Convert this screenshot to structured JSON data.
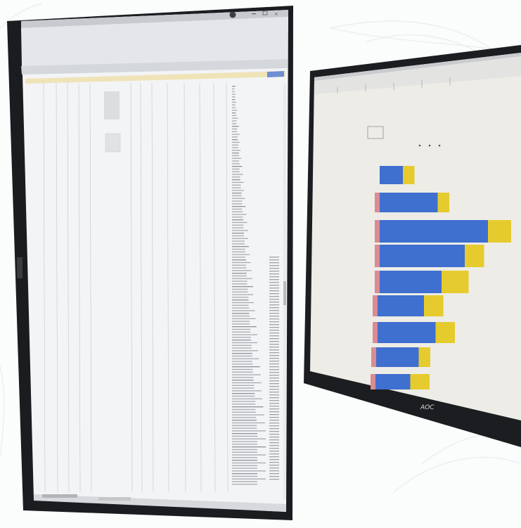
{
  "scene": {
    "description_free": true,
    "left_monitor": {
      "content": "spreadsheet",
      "orientation": "portrait"
    },
    "right_monitor": {
      "content": "bar-chart",
      "orientation": "landscape",
      "brand_mark": "AOC"
    }
  },
  "chart_data": {
    "type": "bar",
    "orientation": "horizontal",
    "stacked": true,
    "categories": [
      "",
      "",
      "",
      "",
      "",
      "",
      "",
      "",
      ""
    ],
    "series": [
      {
        "values": [
          0,
          1,
          1,
          1,
          1,
          1,
          1,
          1,
          1
        ]
      },
      {
        "values": [
          6,
          15,
          28,
          22,
          16,
          12,
          15,
          11,
          9
        ]
      },
      {
        "values": [
          3,
          3,
          6,
          5,
          7,
          5,
          5,
          3,
          5
        ]
      }
    ],
    "colors": [
      "#d98c93",
      "#3f6fcf",
      "#e6cb2e"
    ],
    "title": "",
    "xlabel": "",
    "ylabel": ""
  },
  "colors": {
    "bezel": "#1a1c1f",
    "spreadsheet_header": "#efe3b8",
    "spreadsheet_bg": "#f2f3f5",
    "chart_bg": "#ecebe6",
    "bar_blue": "#3f6fcf",
    "bar_yellow": "#e6cb2e",
    "bar_pink": "#d98c93"
  }
}
